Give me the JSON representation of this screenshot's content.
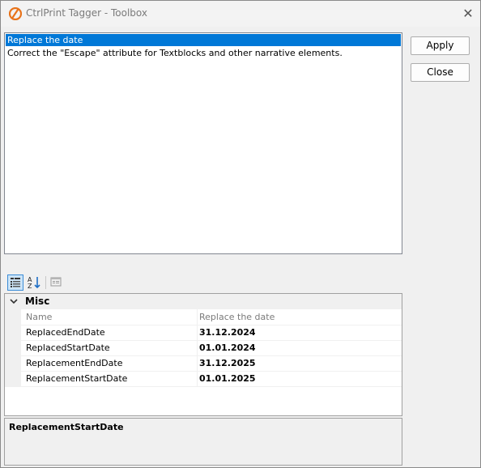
{
  "window": {
    "title": "CtrlPrint Tagger - Toolbox",
    "close_glyph": "✕"
  },
  "tasks": {
    "items": [
      {
        "label": "Replace the date",
        "selected": true
      },
      {
        "label": "Correct the \"Escape\" attribute for Textblocks and other narrative elements.",
        "selected": false
      }
    ]
  },
  "buttons": {
    "apply": "Apply",
    "close": "Close"
  },
  "toolbar": {
    "categorized": "categorized-view-icon",
    "alphabetical": "sort-alphabetical-icon",
    "property_pages": "property-pages-icon",
    "active": "categorized"
  },
  "properties": {
    "category": "Misc",
    "header": {
      "name": "Name",
      "value": "Replace the date"
    },
    "rows": [
      {
        "name": "ReplacedEndDate",
        "value": "31.12.2024"
      },
      {
        "name": "ReplacedStartDate",
        "value": "01.01.2024"
      },
      {
        "name": "ReplacementEndDate",
        "value": "31.12.2025"
      },
      {
        "name": "ReplacementStartDate",
        "value": "01.01.2025"
      }
    ]
  },
  "description": {
    "title": "ReplacementStartDate"
  },
  "colors": {
    "selection": "#0078d7",
    "accent_icon": "#e8731a"
  }
}
